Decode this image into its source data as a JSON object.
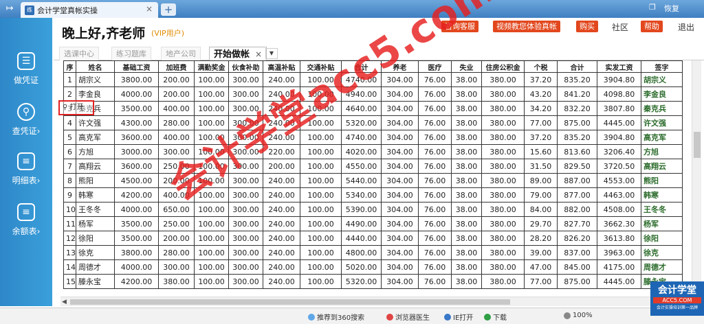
{
  "browser": {
    "tab_title": "会计学堂真帐实操",
    "tab_icon_text": "练",
    "window_restore": "恢复"
  },
  "sidebar": {
    "items": [
      {
        "label": "做凭证",
        "icon": "voucher-icon"
      },
      {
        "label": "查凭证›",
        "icon": "search-icon"
      },
      {
        "label": "明细表›",
        "icon": "list-icon"
      },
      {
        "label": "余额表›",
        "icon": "list-icon"
      }
    ]
  },
  "header": {
    "greeting": "晚上好,齐老师",
    "vip": "(VIP用户)",
    "buttons": [
      "咨询客服",
      "视频教您体验真帐",
      "购买",
      "帮助"
    ],
    "links": [
      "社区",
      "退出"
    ]
  },
  "inner_tabs": [
    "选课中心",
    "练习题库",
    "地产公司",
    "开始做帐"
  ],
  "table": {
    "headers": [
      "序",
      "姓名",
      "基础工资",
      "加班费",
      "满勤奖金",
      "伙食补助",
      "高温补贴",
      "交通补贴",
      "合计",
      "养老",
      "医疗",
      "失业",
      "住房公积金",
      "个税",
      "合计",
      "实发工资",
      "签字"
    ],
    "rows": [
      [
        "1",
        "胡宗义",
        "3800.00",
        "200.00",
        "100.00",
        "300.00",
        "240.00",
        "100.00",
        "4740.00",
        "304.00",
        "76.00",
        "38.00",
        "380.00",
        "37.20",
        "835.20",
        "3904.80",
        "胡宗义"
      ],
      [
        "2",
        "李金良",
        "4000.00",
        "200.00",
        "100.00",
        "300.00",
        "240.00",
        "100.00",
        "4940.00",
        "304.00",
        "76.00",
        "38.00",
        "380.00",
        "43.20",
        "841.20",
        "4098.80",
        "李金良"
      ],
      [
        "3",
        "秦克兵",
        "3500.00",
        "400.00",
        "100.00",
        "300.00",
        "240.00",
        "100.00",
        "4640.00",
        "304.00",
        "76.00",
        "38.00",
        "380.00",
        "34.20",
        "832.20",
        "3807.80",
        "秦克兵"
      ],
      [
        "4",
        "许文强",
        "4300.00",
        "280.00",
        "100.00",
        "300.00",
        "240.00",
        "100.00",
        "5320.00",
        "304.00",
        "76.00",
        "38.00",
        "380.00",
        "77.00",
        "875.00",
        "4445.00",
        "许文强"
      ],
      [
        "5",
        "高克军",
        "3600.00",
        "400.00",
        "100.00",
        "300.00",
        "240.00",
        "100.00",
        "4740.00",
        "304.00",
        "76.00",
        "38.00",
        "380.00",
        "37.20",
        "835.20",
        "3904.80",
        "高克军"
      ],
      [
        "6",
        "方旭",
        "3000.00",
        "300.00",
        "100.00",
        "300.00",
        "220.00",
        "100.00",
        "4020.00",
        "304.00",
        "76.00",
        "38.00",
        "380.00",
        "15.60",
        "813.60",
        "3206.40",
        "方旭"
      ],
      [
        "7",
        "高翔云",
        "3600.00",
        "250.00",
        "100.00",
        "300.00",
        "200.00",
        "100.00",
        "4550.00",
        "304.00",
        "76.00",
        "38.00",
        "380.00",
        "31.50",
        "829.50",
        "3720.50",
        "高翔云"
      ],
      [
        "8",
        "熊阳",
        "4500.00",
        "200.00",
        "100.00",
        "300.00",
        "240.00",
        "100.00",
        "5440.00",
        "304.00",
        "76.00",
        "38.00",
        "380.00",
        "89.00",
        "887.00",
        "4553.00",
        "熊阳"
      ],
      [
        "9",
        "韩寒",
        "4200.00",
        "400.00",
        "100.00",
        "300.00",
        "240.00",
        "100.00",
        "5340.00",
        "304.00",
        "76.00",
        "38.00",
        "380.00",
        "79.00",
        "877.00",
        "4463.00",
        "韩寒"
      ],
      [
        "10",
        "王冬冬",
        "4000.00",
        "650.00",
        "100.00",
        "300.00",
        "240.00",
        "100.00",
        "5390.00",
        "304.00",
        "76.00",
        "38.00",
        "380.00",
        "84.00",
        "882.00",
        "4508.00",
        "王冬冬"
      ],
      [
        "11",
        "杨军",
        "3500.00",
        "250.00",
        "100.00",
        "300.00",
        "240.00",
        "100.00",
        "4490.00",
        "304.00",
        "76.00",
        "38.00",
        "380.00",
        "29.70",
        "827.70",
        "3662.30",
        "杨军"
      ],
      [
        "12",
        "徐阳",
        "3500.00",
        "200.00",
        "100.00",
        "300.00",
        "240.00",
        "100.00",
        "4440.00",
        "304.00",
        "76.00",
        "38.00",
        "380.00",
        "28.20",
        "826.20",
        "3613.80",
        "徐阳"
      ],
      [
        "13",
        "徐克",
        "3800.00",
        "280.00",
        "100.00",
        "300.00",
        "240.00",
        "100.00",
        "4800.00",
        "304.00",
        "76.00",
        "38.00",
        "380.00",
        "39.00",
        "837.00",
        "3963.00",
        "徐克"
      ],
      [
        "14",
        "周德才",
        "4000.00",
        "300.00",
        "100.00",
        "300.00",
        "240.00",
        "100.00",
        "5020.00",
        "304.00",
        "76.00",
        "38.00",
        "380.00",
        "47.00",
        "845.00",
        "4175.00",
        "周德才"
      ],
      [
        "15",
        "滕永宝",
        "4200.00",
        "380.00",
        "100.00",
        "300.00",
        "240.00",
        "100.00",
        "5320.00",
        "304.00",
        "76.00",
        "38.00",
        "380.00",
        "77.00",
        "875.00",
        "4445.00",
        "滕永宝"
      ]
    ]
  },
  "hover_box": "打开",
  "watermark": "会计学堂acc5.com",
  "statusbar": {
    "items": [
      "推荐到360搜索",
      "浏览器医生",
      "IE打开",
      "下载",
      "100%"
    ]
  },
  "logo": {
    "line1": "会计学堂",
    "line2": "ACC5.COM",
    "line3": "会计实操培训第一品牌"
  }
}
